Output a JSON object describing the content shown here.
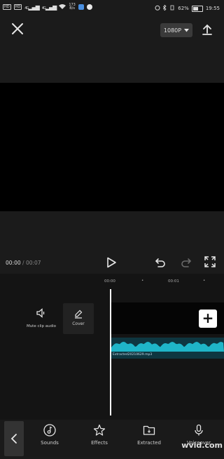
{
  "status_bar": {
    "sim1": "HD",
    "sim2": "HD",
    "signal1": "4G",
    "signal2": "4G",
    "net_speed_value": "173",
    "net_speed_unit": "B/s",
    "battery_percent_text": "62%",
    "battery_level": 0.62,
    "time": "19:55"
  },
  "toolbar": {
    "resolution": "1080P"
  },
  "player": {
    "current_time": "00:00",
    "separator": "/",
    "total_time": "00:07"
  },
  "timeline": {
    "ruler_labels": [
      "00:00",
      "00:01"
    ],
    "mute_label": "Mute clip audio",
    "cover_label": "Cover",
    "audio_clip_name": "Extracted20210629.mp3"
  },
  "bottom_toolbar": {
    "items": [
      {
        "label": "Sounds",
        "icon": "music-note-icon"
      },
      {
        "label": "Effects",
        "icon": "sparkle-star-icon"
      },
      {
        "label": "Extracted",
        "icon": "folder-icon"
      },
      {
        "label": "Voiceover",
        "icon": "microphone-icon"
      }
    ]
  },
  "watermark": "wvid.com",
  "colors": {
    "background": "#1b1b1b",
    "audio_wave": "#1fb5c8",
    "add_button": "#ffffff"
  }
}
